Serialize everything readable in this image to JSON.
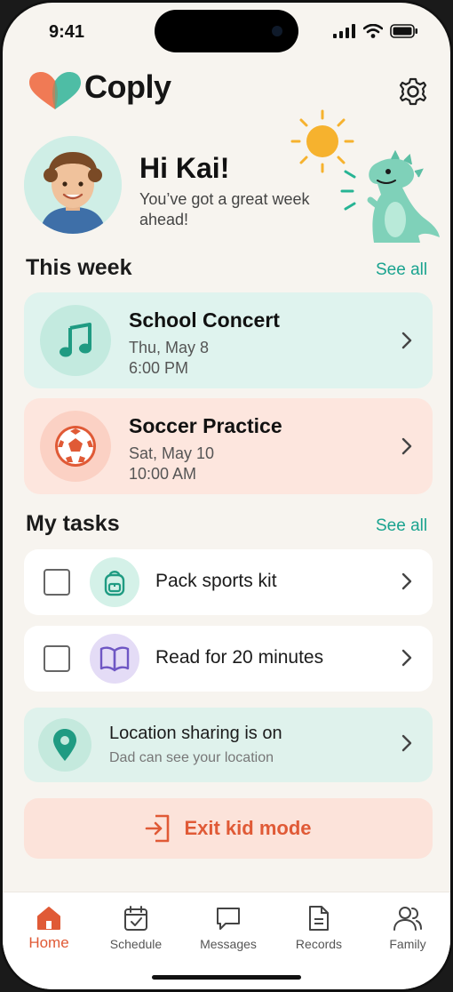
{
  "status_bar": {
    "time": "9:41"
  },
  "header": {
    "app_name": "Coply"
  },
  "greeting": {
    "title": "Hi Kai!",
    "subtitle": "You’ve got a great week ahead!"
  },
  "this_week": {
    "title": "This week",
    "see_all": "See all",
    "events": [
      {
        "title": "School Concert",
        "date": "Thu, May 8",
        "time": "6:00 PM",
        "icon": "music-note-icon",
        "color": "#1f9b82"
      },
      {
        "title": "Soccer Practice",
        "date": "Sat, May 10",
        "time": "10:00 AM",
        "icon": "soccer-ball-icon",
        "color": "#e05a36"
      }
    ]
  },
  "tasks": {
    "title": "My tasks",
    "see_all": "See all",
    "items": [
      {
        "label": "Pack sports kit",
        "icon": "backpack-icon",
        "checked": false
      },
      {
        "label": "Read for 20 minutes",
        "icon": "book-icon",
        "checked": false
      }
    ]
  },
  "location": {
    "title": "Location sharing is on",
    "subtitle": "Dad can see your location",
    "icon": "location-pin-icon"
  },
  "exit": {
    "label": "Exit kid mode",
    "icon": "exit-icon"
  },
  "tabbar": {
    "tabs": [
      {
        "label": "Home",
        "icon": "home-icon",
        "active": true
      },
      {
        "label": "Schedule",
        "icon": "calendar-icon",
        "active": false
      },
      {
        "label": "Messages",
        "icon": "message-icon",
        "active": false
      },
      {
        "label": "Records",
        "icon": "document-icon",
        "active": false
      },
      {
        "label": "Family",
        "icon": "family-icon",
        "active": false
      }
    ]
  },
  "colors": {
    "accent": "#1aa38f",
    "orange": "#e05a36",
    "background": "#f7f4ef"
  }
}
